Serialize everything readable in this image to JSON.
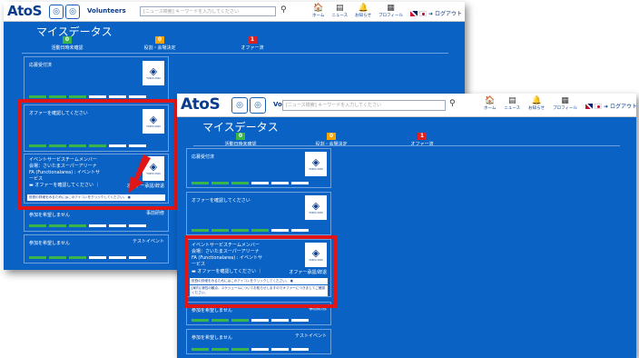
{
  "header": {
    "logo_text": "AtoS",
    "volunteers_label": "Volunteers",
    "search_placeholder": "[ニュース検索] キーワードを入力してください",
    "nav": [
      {
        "icon": "home-icon",
        "glyph": "🏠",
        "label": "ホーム"
      },
      {
        "icon": "news-icon",
        "glyph": "▤",
        "label": "ニュース"
      },
      {
        "icon": "bell-icon",
        "glyph": "🔔",
        "label": "お知らせ"
      },
      {
        "icon": "profile-icon",
        "glyph": "▦",
        "label": "プロフィール"
      }
    ],
    "logout_label": "ログアウト"
  },
  "page": {
    "title": "マイスデータス",
    "stats": [
      {
        "count": "0",
        "label": "活動日時未確認",
        "color": "#39b54a"
      },
      {
        "count": "0",
        "label": "役割・会場決定",
        "color": "#f7a400"
      },
      {
        "count": "1",
        "label": "オファー済",
        "color": "#e02020"
      }
    ]
  },
  "cards": {
    "applied": {
      "title": "応募受付済"
    },
    "offer": {
      "title": "オファーを確認してください"
    },
    "event": {
      "title": "イベントサービスチームメンバー",
      "venue": "会場：さいたまスーパーアリーナ",
      "fa_line1": "FA (Functionalarea) : イベントサ",
      "fa_line2": "ービス",
      "confirm": "オファーを確認してください ｜",
      "offer_status": "オファー承認/辞退",
      "note1": "役割の詳細をみるためにはこのアイコンをクリックしてください。",
      "note2": "[案内] 適性の観点、スケジュールについてお知らせしますのでオファーにつきましてご確認ください。"
    },
    "nocheck1": {
      "title": "参加を希望しません",
      "status": "事前研修"
    },
    "nocheck2": {
      "title": "参加を希望しません",
      "status": "テストイベント"
    }
  },
  "crest_caption": "TOKYO 2020",
  "colors": {
    "page_bg": "#0a62c4",
    "highlight": "#e01616",
    "progress_done": "#39b54a"
  }
}
